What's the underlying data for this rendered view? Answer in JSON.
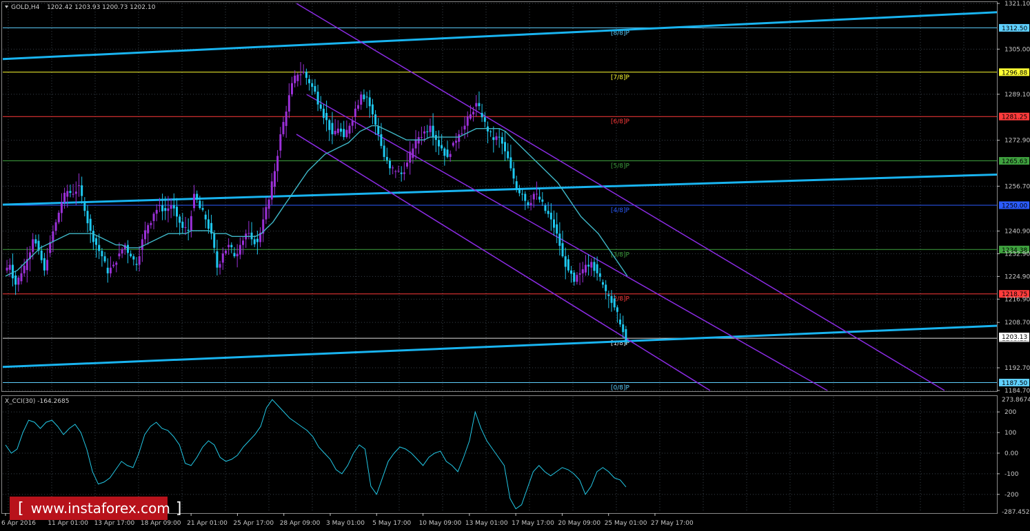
{
  "header": {
    "symbol": "GOLD,H4",
    "ohlc": "1202.42 1203.93 1200.73 1202.10"
  },
  "indicator": {
    "label": "X_CCI(30) -164.2685",
    "max_label": "273.8674",
    "min_label": "-287.4521",
    "ticks": [
      "200",
      "100",
      "0.00",
      "-100",
      "-200"
    ],
    "tick_values": [
      200,
      100,
      0,
      -100,
      -200
    ]
  },
  "watermark": {
    "text": "www.instaforex.com"
  },
  "colors": {
    "background": "#000000",
    "grid": "#6b7b8c",
    "bull_candle": "#9b30d8",
    "bear_candle": "#1ec8f0",
    "ma_line": "#3fb8c8",
    "channel": "#8a2be2",
    "trendline": "#19b4f0",
    "cci_line": "#22c8e6"
  },
  "chart_data": [
    {
      "type": "candlestick",
      "title": "GOLD,H4",
      "ylim": [
        1184.7,
        1321.1
      ],
      "y_ticks": [
        "1321.10",
        "1305.00",
        "1289.10",
        "1272.90",
        "1256.70",
        "1240.90",
        "1232.90",
        "1224.90",
        "1216.90",
        "1208.70",
        "1192.70",
        "1184.70"
      ],
      "x_ticks": [
        "6 Apr 2016",
        "11 Apr 01:00",
        "13 Apr 17:00",
        "18 Apr 09:00",
        "21 Apr 01:00",
        "25 Apr 17:00",
        "28 Apr 09:00",
        "3 May 01:00",
        "5 May 17:00",
        "10 May 09:00",
        "13 May 01:00",
        "17 May 17:00",
        "20 May 09:00",
        "25 May 01:00",
        "27 May 17:00"
      ],
      "close_series": [
        1229,
        1222,
        1226,
        1231,
        1238,
        1234,
        1227,
        1237,
        1244,
        1251,
        1255,
        1254,
        1257,
        1248,
        1241,
        1236,
        1232,
        1226,
        1229,
        1233,
        1236,
        1232,
        1229,
        1238,
        1243,
        1247,
        1250,
        1248,
        1250,
        1246,
        1242,
        1241,
        1254,
        1249,
        1245,
        1240,
        1228,
        1233,
        1236,
        1232,
        1236,
        1240,
        1238,
        1237,
        1245,
        1252,
        1262,
        1275,
        1283,
        1293,
        1296,
        1297,
        1293,
        1290,
        1284,
        1280,
        1275,
        1277,
        1274,
        1278,
        1284,
        1289,
        1288,
        1282,
        1275,
        1267,
        1263,
        1262,
        1261,
        1265,
        1270,
        1274,
        1276,
        1278,
        1273,
        1270,
        1267,
        1272,
        1275,
        1278,
        1282,
        1286,
        1281,
        1276,
        1273,
        1274,
        1269,
        1263,
        1256,
        1254,
        1250,
        1254,
        1252,
        1248,
        1245,
        1240,
        1232,
        1227,
        1223,
        1226,
        1229,
        1230,
        1226,
        1222,
        1218,
        1214,
        1208,
        1202.1
      ],
      "moving_average_series": [
        1225,
        1226,
        1227,
        1229,
        1231,
        1233,
        1235,
        1236,
        1237,
        1238,
        1239,
        1240,
        1240,
        1240,
        1240,
        1240,
        1239,
        1238,
        1237,
        1236,
        1236,
        1235,
        1235,
        1235,
        1236,
        1237,
        1238,
        1239,
        1240,
        1240,
        1240,
        1240,
        1241,
        1241,
        1241,
        1241,
        1240,
        1240,
        1240,
        1239,
        1239,
        1239,
        1239,
        1239,
        1240,
        1242,
        1244,
        1247,
        1250,
        1253,
        1256,
        1259,
        1262,
        1264,
        1266,
        1268,
        1269,
        1270,
        1271,
        1272,
        1274,
        1276,
        1277,
        1278,
        1278,
        1277,
        1276,
        1275,
        1274,
        1273,
        1273,
        1273,
        1273,
        1274,
        1274,
        1274,
        1274,
        1274,
        1274,
        1275,
        1276,
        1277,
        1277,
        1277,
        1277,
        1277,
        1276,
        1274,
        1272,
        1270,
        1268,
        1266,
        1264,
        1262,
        1260,
        1258,
        1255,
        1252,
        1249,
        1246,
        1244,
        1242,
        1240,
        1237,
        1234,
        1231,
        1228,
        1225
      ],
      "horizontal_levels": [
        {
          "label": "[8/8]P",
          "price": "1312.50",
          "color": "#5fd0ff"
        },
        {
          "label": "[7/8]P",
          "price": "1296.88",
          "color": "#ffff33"
        },
        {
          "label": "[6/8]P",
          "price": "1281.25",
          "color": "#ff3b3b"
        },
        {
          "label": "[5/8]P",
          "price": "1265.63",
          "color": "#3fa23f"
        },
        {
          "label": "[4/8]P",
          "price": "1250.00",
          "color": "#2b5cff"
        },
        {
          "label": "[3/8]P",
          "price": "1234.38",
          "color": "#3fa23f"
        },
        {
          "label": "[2/8]P",
          "price": "1218.75",
          "color": "#ff3b3b"
        },
        {
          "label": "[1/8]P",
          "price": "1203.13",
          "color": "#e0e0e0"
        },
        {
          "label": "[0/8]P",
          "price": "1187.50",
          "color": "#5fd0ff"
        }
      ],
      "current_price": "1203.13"
    },
    {
      "type": "line",
      "title": "X_CCI(30)",
      "ylim": [
        -287.4521,
        273.8674
      ],
      "values": [
        40,
        0,
        20,
        100,
        160,
        150,
        120,
        150,
        160,
        130,
        90,
        120,
        140,
        100,
        20,
        -90,
        -150,
        -140,
        -120,
        -80,
        -40,
        -60,
        -70,
        0,
        90,
        130,
        150,
        120,
        110,
        80,
        40,
        -50,
        -60,
        -20,
        30,
        60,
        40,
        -20,
        -40,
        -30,
        -10,
        30,
        60,
        90,
        130,
        220,
        260,
        230,
        200,
        170,
        150,
        130,
        110,
        80,
        30,
        0,
        -30,
        -80,
        -100,
        -60,
        0,
        40,
        20,
        -160,
        -200,
        -120,
        -40,
        0,
        30,
        20,
        0,
        -30,
        -60,
        -20,
        0,
        10,
        -40,
        -60,
        -90,
        -20,
        60,
        200,
        120,
        60,
        20,
        -20,
        -60,
        -220,
        -270,
        -250,
        -170,
        -90,
        -60,
        -90,
        -110,
        -90,
        -70,
        -80,
        -100,
        -130,
        -200,
        -160,
        -90,
        -70,
        -90,
        -120,
        -130,
        -164
      ]
    }
  ]
}
